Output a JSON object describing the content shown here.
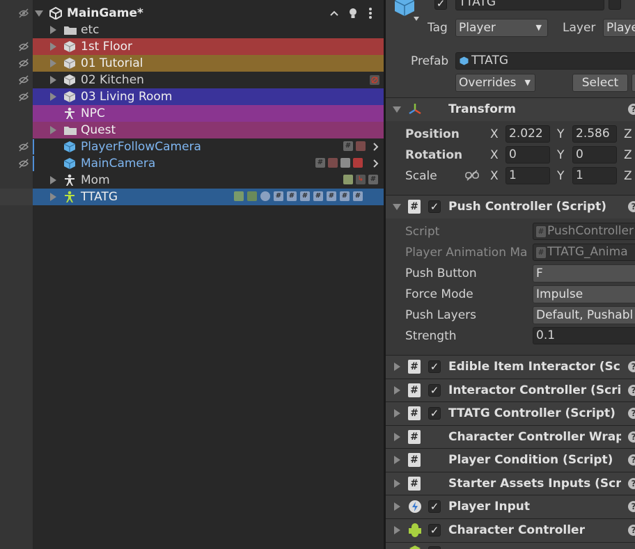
{
  "hierarchy": {
    "scene_name": "MainGame*",
    "items": [
      {
        "label": "etc",
        "icon": "folder-icon"
      },
      {
        "label": "1st Floor",
        "icon": "cube-icon",
        "color": "#a33b3b"
      },
      {
        "label": "01 Tutorial",
        "icon": "cube-icon",
        "color": "#8a6a2d"
      },
      {
        "label": "02 Kitchen",
        "icon": "cube-icon"
      },
      {
        "label": "03 Living Room",
        "icon": "cube-icon",
        "color": "#3a339a"
      },
      {
        "label": "NPC",
        "icon": "humanoid-icon",
        "color": "#8a3590"
      },
      {
        "label": "Quest",
        "icon": "folder-icon",
        "color": "#8a3570"
      },
      {
        "label": "PlayerFollowCamera",
        "icon": "prefab-cube-icon"
      },
      {
        "label": "MainCamera",
        "icon": "prefab-cube-icon"
      },
      {
        "label": "Mom",
        "icon": "humanoid-icon"
      },
      {
        "label": "TTATG",
        "icon": "humanoid-icon",
        "color": "#2c5d92"
      }
    ]
  },
  "inspector": {
    "object_name": "TTATG",
    "tag_label": "Tag",
    "tag_value": "Player",
    "layer_label": "Layer",
    "layer_value": "Playe",
    "prefab_label": "Prefab",
    "prefab_value": "TTATG",
    "overrides_label": "Overrides",
    "select_label": "Select",
    "transform": {
      "title": "Transform",
      "position_label": "Position",
      "rotation_label": "Rotation",
      "scale_label": "Scale",
      "x": "X",
      "y": "Y",
      "z": "Z",
      "pos_x": "2.022",
      "pos_y": "2.586",
      "rot_x": "0",
      "rot_y": "0",
      "scale_x": "1",
      "scale_y": "1"
    },
    "push_controller": {
      "title": "Push Controller (Script)",
      "script_label": "Script",
      "script_value": "PushController",
      "anim_label": "Player Animation Ma",
      "anim_value": "TTATG_Anima",
      "push_button_label": "Push Button",
      "push_button_value": "F",
      "force_mode_label": "Force Mode",
      "force_mode_value": "Impulse",
      "push_layers_label": "Push Layers",
      "push_layers_value": "Default, Pushabl",
      "strength_label": "Strength",
      "strength_value": "0.1"
    },
    "components": [
      "Edible Item Interactor (Scri",
      "Interactor Controller (Scrip",
      "TTATG Controller (Script)",
      "Character Controller Wrapp",
      "Player Condition (Script)",
      "Starter Assets Inputs (Scri",
      "Player Input",
      "Character Controller"
    ]
  }
}
